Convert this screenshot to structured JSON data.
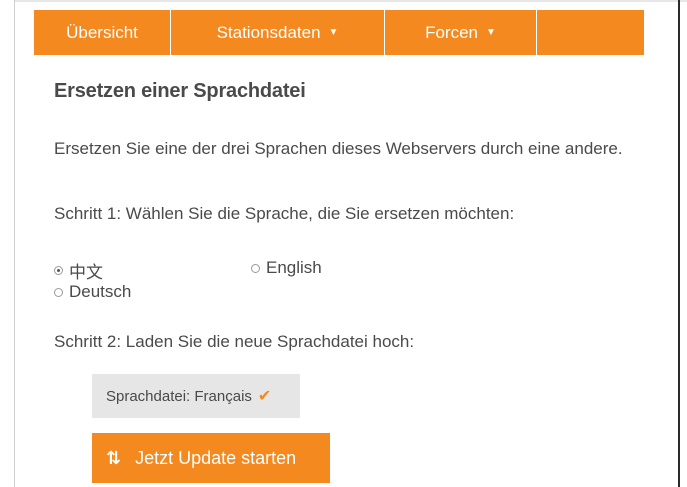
{
  "nav": {
    "items": [
      {
        "label": "Übersicht",
        "caret": ""
      },
      {
        "label": "Stationsdaten",
        "caret": "▼"
      },
      {
        "label": "Forcen",
        "caret": "▼"
      },
      {
        "label": "",
        "caret": ""
      }
    ]
  },
  "page": {
    "title": "Ersetzen einer Sprachdatei",
    "description": "Ersetzen Sie eine der drei Sprachen dieses Webservers durch eine andere.",
    "step1": "Schritt 1: Wählen Sie die Sprache, die Sie ersetzen möchten:",
    "step2": "Schritt 2: Laden Sie die neue Sprachdatei hoch:"
  },
  "languages": [
    {
      "label": "中文",
      "selected": true
    },
    {
      "label": "English",
      "selected": false
    },
    {
      "label": "Deutsch",
      "selected": false
    }
  ],
  "file": {
    "label": "Sprachdatei: Français",
    "status_icon": "check-icon"
  },
  "actions": {
    "update_label": "Jetzt Update starten",
    "update_icon": "refresh-icon"
  },
  "colors": {
    "accent": "#f3891f",
    "chip_bg": "#e6e6e6",
    "text": "#4a4a4a"
  }
}
